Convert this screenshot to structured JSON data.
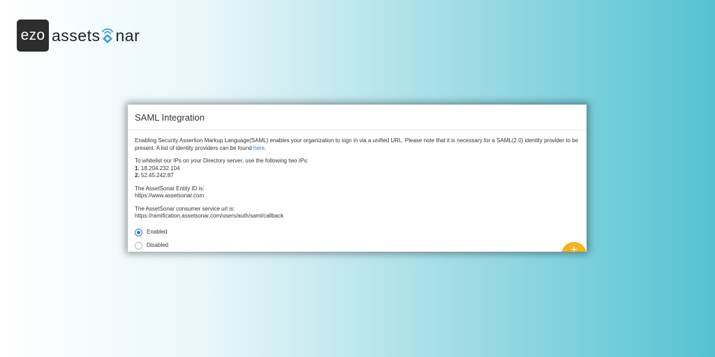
{
  "logo": {
    "ezo": "ezo",
    "word_prefix": "assets",
    "word_suffix": "nar",
    "icon": "sonar-diamond-icon",
    "brand_color": "#2a9fd6"
  },
  "card": {
    "title": "SAML Integration",
    "intro": "Enabling Security Assertion Markup Language(SAML) enables your organization to sign in via a unified URL. Please note that it is necessary for a SAML(2.0) identity provider to be present. A list of identity providers can be found",
    "intro_link": "here",
    "intro_end": ".",
    "whitelist_label": "To whitelist our IPs on your Directory server, use the following two IPs:",
    "ips": [
      {
        "num": "1.",
        "ip": "18.204.232.104"
      },
      {
        "num": "2.",
        "ip": "52.45.242.87"
      }
    ],
    "entity_label": "The AssetSonar Entity ID is:",
    "entity_value": "https://www.assetsonar.com",
    "consumer_label": "The AssetSonar consumer service url is:",
    "consumer_value": "https://ramification.assetsonar.com/users/auth/saml/callback",
    "options": [
      {
        "label": "Enabled",
        "checked": true
      },
      {
        "label": "Disabled",
        "checked": false
      }
    ],
    "fab_label": "+",
    "link_color": "#2a7fc4",
    "fab_color": "#f5b21c"
  }
}
